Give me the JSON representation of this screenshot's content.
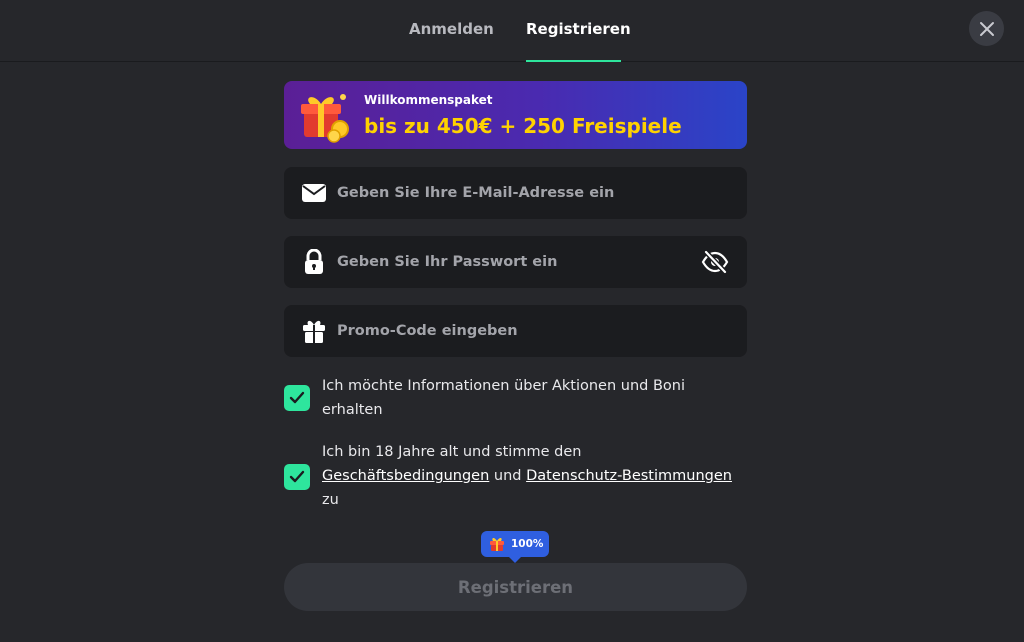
{
  "tabs": {
    "login_label": "Anmelden",
    "register_label": "Registrieren",
    "active": "register"
  },
  "banner": {
    "subtitle": "Willkommenspaket",
    "headline": "bis zu 450€ + 250 Freispiele",
    "icon": "gift-icon"
  },
  "form": {
    "email": {
      "placeholder": "Geben Sie Ihre E-Mail-Adresse ein",
      "value": "",
      "icon": "mail-icon"
    },
    "password": {
      "placeholder": "Geben Sie Ihr Passwort ein",
      "value": "",
      "icon": "lock-icon",
      "toggle_icon": "eye-off-icon"
    },
    "promo": {
      "placeholder": "Promo-Code eingeben",
      "value": "",
      "icon": "gift-icon"
    }
  },
  "checkboxes": {
    "marketing": {
      "checked": true,
      "text": "Ich möchte Informationen über Aktionen und Boni erhalten"
    },
    "terms": {
      "checked": true,
      "text_before": "Ich bin 18 Jahre alt und stimme den ",
      "link_terms": "Geschäftsbedingungen",
      "text_middle": " und ",
      "link_privacy": "Datenschutz-Bestimmungen",
      "text_after": " zu"
    }
  },
  "bonus_badge": {
    "label": "100%",
    "icon": "gift-icon"
  },
  "submit": {
    "label": "Registrieren",
    "enabled": false
  },
  "colors": {
    "background": "#26272b",
    "field_bg": "#1b1c1f",
    "accent": "#2ee59d",
    "banner_highlight": "#ffd200",
    "badge_bg": "#2f5fe0",
    "button_bg": "#33353b"
  }
}
